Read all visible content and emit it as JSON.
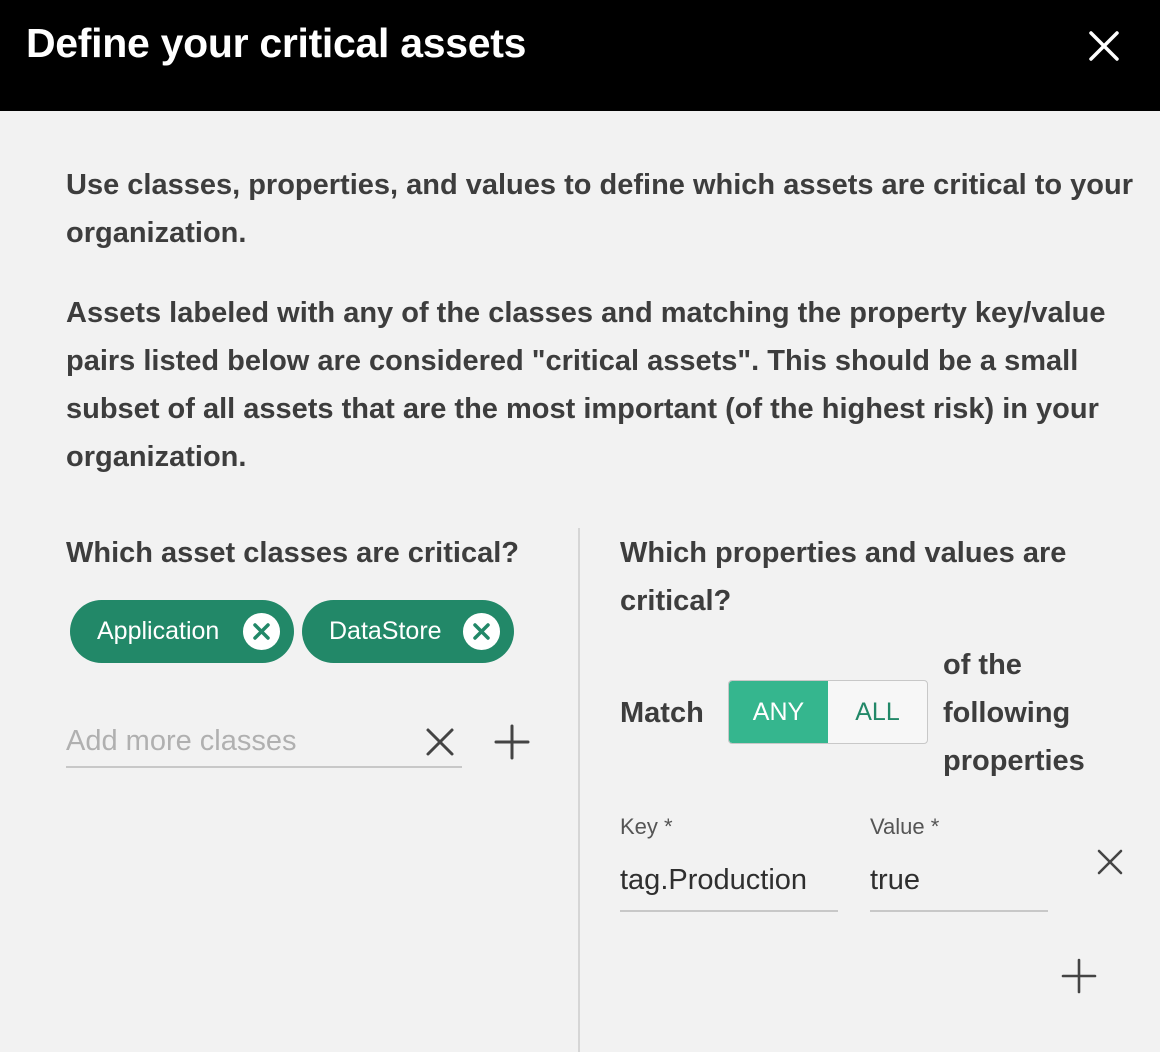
{
  "dialog": {
    "title": "Define your critical assets",
    "close_icon": "close-icon"
  },
  "intro": {
    "paragraph1": "Use classes, properties, and values to define which assets are critical to your organization.",
    "paragraph2": "Assets labeled with any of the classes and matching the property key/value pairs listed below are considered \"critical assets\". This should be a small subset of all assets that are the most important (of the highest risk) in your organization."
  },
  "classes": {
    "heading": "Which asset classes are critical?",
    "chips": [
      {
        "label": "Application",
        "remove_icon": "remove-circle-icon"
      },
      {
        "label": "DataStore",
        "remove_icon": "remove-circle-icon"
      }
    ],
    "input_placeholder": "Add more classes",
    "input_value": "",
    "clear_icon": "close-icon",
    "add_icon": "plus-icon"
  },
  "properties": {
    "heading": "Which properties and values are critical?",
    "match_label": "Match",
    "match_options": [
      "ANY",
      "ALL"
    ],
    "match_selected": "ANY",
    "following_text": "of the following properties",
    "key_label": "Key *",
    "value_label": "Value *",
    "rows": [
      {
        "key": "tag.Production",
        "value": "true",
        "remove_icon": "close-icon"
      }
    ],
    "add_icon": "plus-icon"
  },
  "colors": {
    "header_bg": "#000000",
    "chip_bg": "#228868",
    "toggle_active": "#35b68e",
    "page_bg": "#f2f2f2"
  }
}
